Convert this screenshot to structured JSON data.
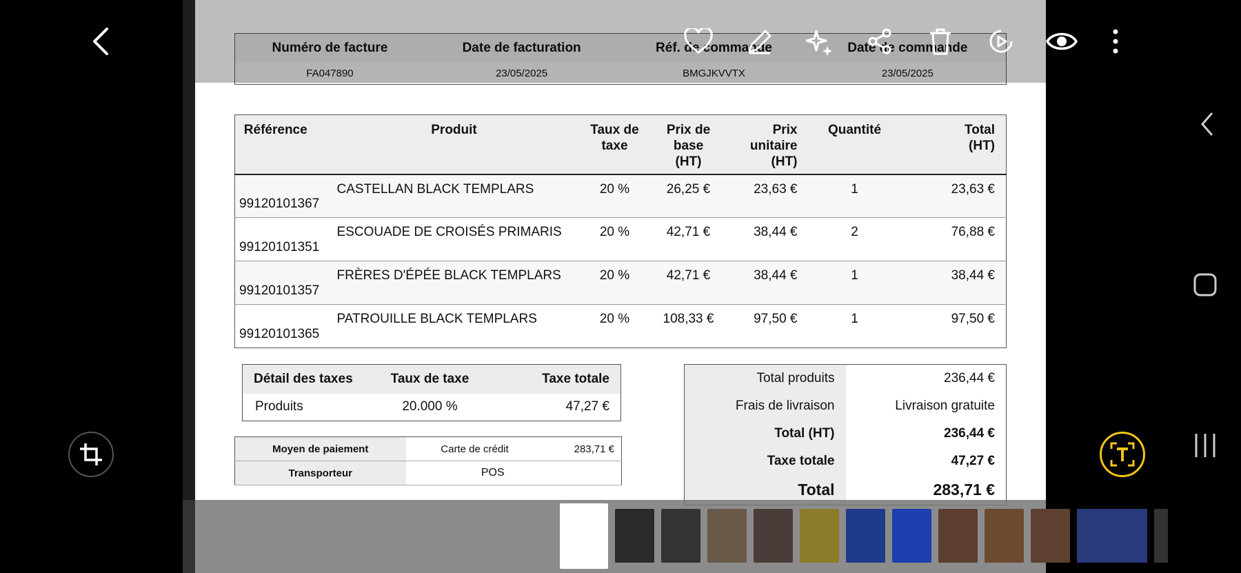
{
  "invoice_header": {
    "columns": [
      "Numéro de facture",
      "Date de facturation",
      "Réf. de commande",
      "Date de commande"
    ],
    "values": [
      "FA047890",
      "23/05/2025",
      "BMGJKVVTX",
      "23/05/2025"
    ]
  },
  "products": {
    "columns": [
      "Référence",
      "Produit",
      "Taux de taxe",
      "Prix de base (HT)",
      "Prix unitaire (HT)",
      "Quantité",
      "Total (HT)"
    ],
    "rows": [
      {
        "ref": "99120101367",
        "product": "CASTELLAN BLACK TEMPLARS",
        "tax": "20 %",
        "base": "26,25 €",
        "unit": "23,63 €",
        "qty": "1",
        "total": "23,63 €"
      },
      {
        "ref": "99120101351",
        "product": "ESCOUADE DE CROISÉS PRIMARIS",
        "tax": "20 %",
        "base": "42,71 €",
        "unit": "38,44 €",
        "qty": "2",
        "total": "76,88 €"
      },
      {
        "ref": "99120101357",
        "product": "FRÈRES D'ÉPÉE BLACK TEMPLARS",
        "tax": "20 %",
        "base": "42,71 €",
        "unit": "38,44 €",
        "qty": "1",
        "total": "38,44 €"
      },
      {
        "ref": "99120101365",
        "product": "PATROUILLE BLACK TEMPLARS",
        "tax": "20 %",
        "base": "108,33 €",
        "unit": "97,50 €",
        "qty": "1",
        "total": "97,50 €"
      }
    ]
  },
  "tax_detail": {
    "columns": [
      "Détail des taxes",
      "Taux de taxe",
      "Taxe totale"
    ],
    "row": [
      "Produits",
      "20.000 %",
      "47,27 €"
    ]
  },
  "payment": {
    "method_label": "Moyen de paiement",
    "method_value": "Carte de crédit",
    "method_amount": "283,71 €",
    "carrier_label": "Transporteur",
    "carrier_value": "POS"
  },
  "totals": {
    "products_label": "Total produits",
    "products_value": "236,44 €",
    "shipping_label": "Frais de livraison",
    "shipping_value": "Livraison gratuite",
    "ht_label": "Total (HT)",
    "ht_value": "236,44 €",
    "tax_label": "Taxe totale",
    "tax_value": "47,27 €",
    "total_label": "Total",
    "total_value": "283,71 €"
  },
  "toolbar_icons": [
    "back-icon",
    "heart-icon",
    "edit-icon",
    "sparkle-icon",
    "share-icon",
    "trash-icon",
    "rotate-play-icon",
    "eye-icon",
    "more-icon"
  ],
  "side_icons": [
    "crop-icon",
    "text-extract-icon"
  ],
  "nav_icons": [
    "nav-back-icon",
    "nav-home-icon",
    "nav-recents-icon"
  ],
  "colors": {
    "accent_yellow": "#f5c518",
    "background": "#000000"
  }
}
